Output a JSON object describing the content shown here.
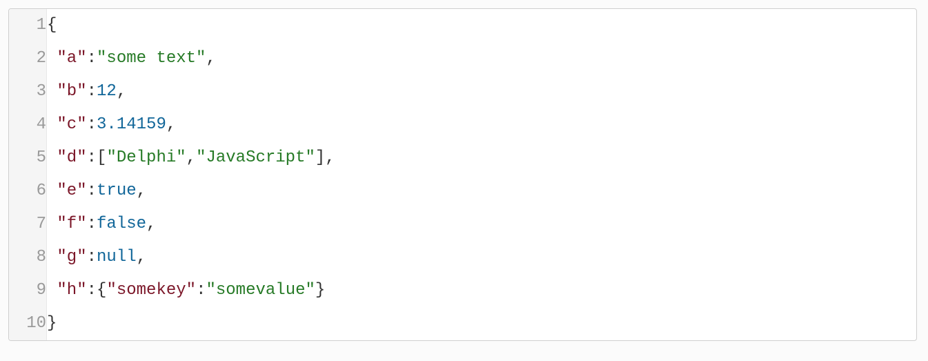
{
  "editor": {
    "lines": [
      {
        "num": "1",
        "tokens": [
          {
            "cls": "tok-punct",
            "t": "{"
          }
        ]
      },
      {
        "num": "2",
        "tokens": [
          {
            "cls": "tok-punct",
            "t": " "
          },
          {
            "cls": "tok-key",
            "t": "\"a\""
          },
          {
            "cls": "tok-punct",
            "t": ":"
          },
          {
            "cls": "tok-str",
            "t": "\"some text\""
          },
          {
            "cls": "tok-punct",
            "t": ","
          }
        ]
      },
      {
        "num": "3",
        "tokens": [
          {
            "cls": "tok-punct",
            "t": " "
          },
          {
            "cls": "tok-key",
            "t": "\"b\""
          },
          {
            "cls": "tok-punct",
            "t": ":"
          },
          {
            "cls": "tok-num",
            "t": "12"
          },
          {
            "cls": "tok-punct",
            "t": ","
          }
        ]
      },
      {
        "num": "4",
        "tokens": [
          {
            "cls": "tok-punct",
            "t": " "
          },
          {
            "cls": "tok-key",
            "t": "\"c\""
          },
          {
            "cls": "tok-punct",
            "t": ":"
          },
          {
            "cls": "tok-num",
            "t": "3.14159"
          },
          {
            "cls": "tok-punct",
            "t": ","
          }
        ]
      },
      {
        "num": "5",
        "tokens": [
          {
            "cls": "tok-punct",
            "t": " "
          },
          {
            "cls": "tok-key",
            "t": "\"d\""
          },
          {
            "cls": "tok-punct",
            "t": ":"
          },
          {
            "cls": "tok-punct",
            "t": "["
          },
          {
            "cls": "tok-str",
            "t": "\"Delphi\""
          },
          {
            "cls": "tok-punct",
            "t": ","
          },
          {
            "cls": "tok-str",
            "t": "\"JavaScript\""
          },
          {
            "cls": "tok-punct",
            "t": "]"
          },
          {
            "cls": "tok-punct",
            "t": ","
          }
        ]
      },
      {
        "num": "6",
        "tokens": [
          {
            "cls": "tok-punct",
            "t": " "
          },
          {
            "cls": "tok-key",
            "t": "\"e\""
          },
          {
            "cls": "tok-punct",
            "t": ":"
          },
          {
            "cls": "tok-const",
            "t": "true"
          },
          {
            "cls": "tok-punct",
            "t": ","
          }
        ]
      },
      {
        "num": "7",
        "tokens": [
          {
            "cls": "tok-punct",
            "t": " "
          },
          {
            "cls": "tok-key",
            "t": "\"f\""
          },
          {
            "cls": "tok-punct",
            "t": ":"
          },
          {
            "cls": "tok-const",
            "t": "false"
          },
          {
            "cls": "tok-punct",
            "t": ","
          }
        ]
      },
      {
        "num": "8",
        "tokens": [
          {
            "cls": "tok-punct",
            "t": " "
          },
          {
            "cls": "tok-key",
            "t": "\"g\""
          },
          {
            "cls": "tok-punct",
            "t": ":"
          },
          {
            "cls": "tok-const",
            "t": "null"
          },
          {
            "cls": "tok-punct",
            "t": ","
          }
        ]
      },
      {
        "num": "9",
        "tokens": [
          {
            "cls": "tok-punct",
            "t": " "
          },
          {
            "cls": "tok-key",
            "t": "\"h\""
          },
          {
            "cls": "tok-punct",
            "t": ":"
          },
          {
            "cls": "tok-punct",
            "t": "{"
          },
          {
            "cls": "tok-key",
            "t": "\"somekey\""
          },
          {
            "cls": "tok-punct",
            "t": ":"
          },
          {
            "cls": "tok-str",
            "t": "\"somevalue\""
          },
          {
            "cls": "tok-punct",
            "t": "}"
          }
        ]
      },
      {
        "num": "10",
        "tokens": [
          {
            "cls": "tok-punct",
            "t": "}"
          }
        ]
      }
    ]
  }
}
